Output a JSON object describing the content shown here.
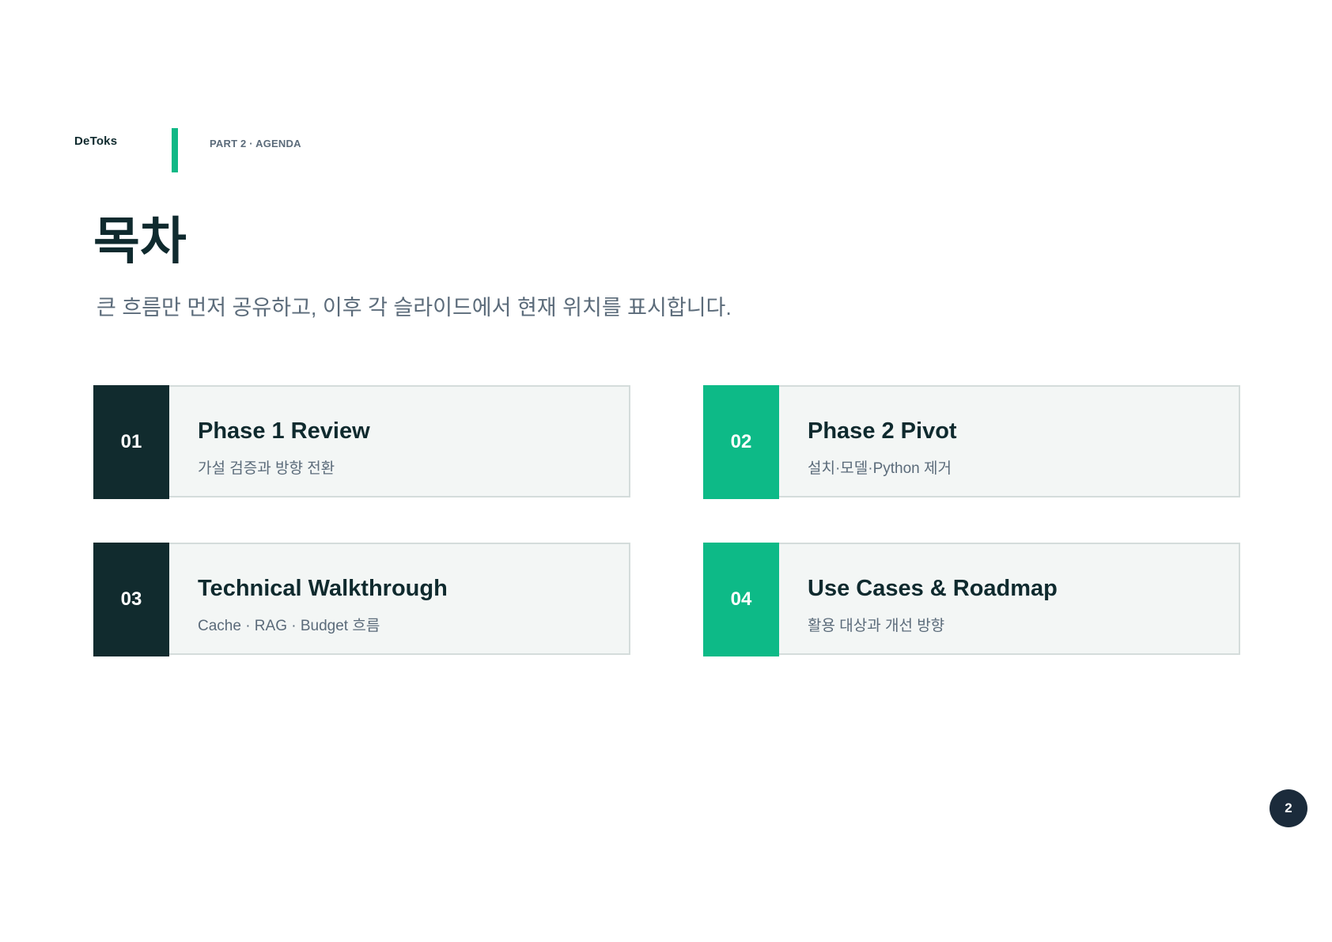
{
  "header": {
    "brand": "DeToks",
    "section_label": "PART 2 · AGENDA",
    "accent_color": "#10b886"
  },
  "main": {
    "title": "목차",
    "subtitle": "큰 흐름만 먼저 공유하고, 이후 각 슬라이드에서 현재 위치를 표시합니다."
  },
  "agenda": [
    {
      "number": "01",
      "title": "Phase 1 Review",
      "description": "가설 검증과 방향 전환",
      "accent": "#112b2e"
    },
    {
      "number": "02",
      "title": "Phase 2 Pivot",
      "description": "설치·모델·Python 제거",
      "accent": "#0dba87"
    },
    {
      "number": "03",
      "title": "Technical Walkthrough",
      "description": "Cache · RAG · Budget 흐름",
      "accent": "#112b2e"
    },
    {
      "number": "04",
      "title": "Use Cases & Roadmap",
      "description": "활용 대상과 개선 방향",
      "accent": "#0dba87"
    }
  ],
  "footer": {
    "page_number": "2"
  }
}
